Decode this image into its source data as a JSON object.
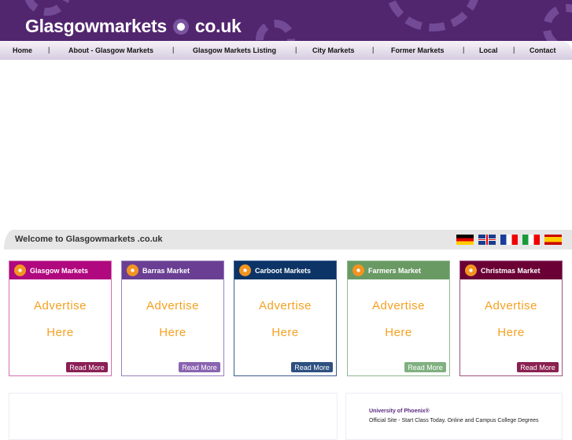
{
  "header": {
    "logo_left": "Glasgowmarkets",
    "logo_right": "co.uk"
  },
  "nav": [
    "Home",
    "About - Glasgow Markets",
    "Glasgow Markets Listing",
    "City Markets",
    "Former Markets",
    "Local",
    "Contact"
  ],
  "welcome": "Welcome to Glasgowmarkets .co.uk",
  "flags": [
    "german",
    "english",
    "french",
    "italian",
    "spanish"
  ],
  "cards": [
    {
      "title": "Glasgow Markets",
      "line1": "Advertise",
      "line2": "Here",
      "button": "Read More",
      "color": "#b0087e"
    },
    {
      "title": "Barras Market",
      "line1": "Advertise",
      "line2": "Here",
      "button": "Read More",
      "color": "#6a3f93"
    },
    {
      "title": "Carboot Markets",
      "line1": "Advertise",
      "line2": "Here",
      "button": "Read More",
      "color": "#0d3466"
    },
    {
      "title": "Farmers Market",
      "line1": "Advertise",
      "line2": "Here",
      "button": "Read More",
      "color": "#6a9a64"
    },
    {
      "title": "Christmas Market",
      "line1": "Advertise",
      "line2": "Here",
      "button": "Read More",
      "color": "#6a0035"
    }
  ],
  "ad": {
    "title": "University of Phoenix®",
    "text": "Official Site - Start Class Today. Online and Campus College Degrees"
  }
}
